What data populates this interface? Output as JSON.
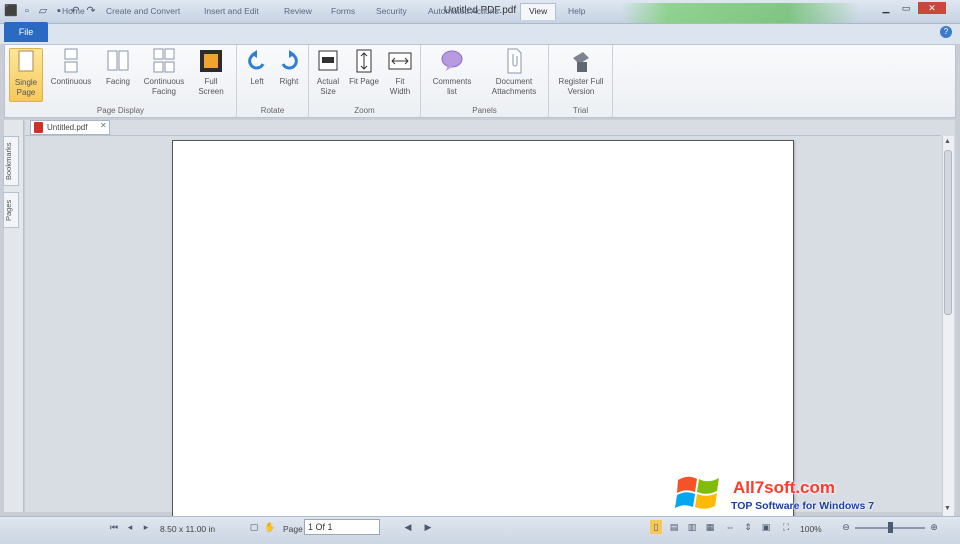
{
  "window": {
    "title": "Untitled PDF.pdf"
  },
  "ribbon_tabs": [
    "File",
    "Home",
    "Create and Convert",
    "Insert and Edit",
    "Review",
    "Forms",
    "Security",
    "Automated Actions",
    "View",
    "Help"
  ],
  "active_tab": "View",
  "ribbon": {
    "groups": [
      {
        "label": "Page Display",
        "buttons": [
          "Single Page",
          "Continuous",
          "Facing",
          "Continuous Facing",
          "Full Screen"
        ]
      },
      {
        "label": "Rotate",
        "buttons": [
          "Left",
          "Right"
        ]
      },
      {
        "label": "Zoom",
        "buttons": [
          "Actual Size",
          "Fit Page",
          "Fit Width"
        ]
      },
      {
        "label": "Panels",
        "buttons": [
          "Comments list",
          "Document Attachments"
        ]
      },
      {
        "label": "Trial",
        "buttons": [
          "Register Full Version"
        ]
      }
    ],
    "selected_button": "Single Page"
  },
  "side_panels": [
    "Bookmarks",
    "Pages"
  ],
  "document_tab": "Untitled.pdf",
  "status": {
    "page_size": "8.50 x 11.00 in",
    "page_label": "Page",
    "page_value": "1 Of 1",
    "zoom": "100%"
  },
  "watermark": {
    "site": "All7soft.com",
    "tagline": "TOP Software for Windows 7"
  },
  "colors": {
    "file_tab": "#2a6ac3",
    "selected_button": "#f6c85a",
    "watermark_red": "#ff3a2a",
    "watermark_blue": "#1a3ea8"
  }
}
